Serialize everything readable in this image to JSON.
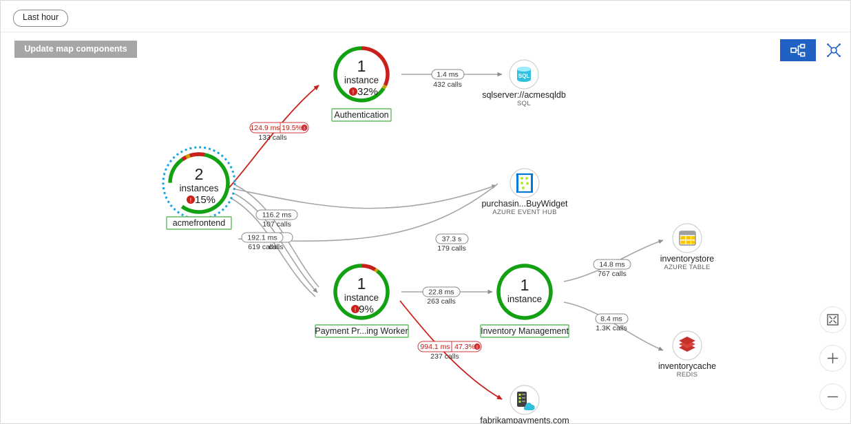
{
  "topbar": {
    "time_range_label": "Last hour"
  },
  "toolbar": {
    "update_map_label": "Update map components",
    "view_hierarchical_icon": "hierarchy-view-icon",
    "view_graph_icon": "graph-view-icon",
    "accent_color": "#1f62c4"
  },
  "zoom_controls": {
    "fit_icon": "fit-to-screen-icon",
    "zoom_in_icon": "plus-icon",
    "zoom_out_icon": "minus-icon"
  },
  "colors": {
    "healthy": "#12a112",
    "error": "#c9201b",
    "warning": "#c8a200",
    "edge": "#a5a5a5",
    "selection": "#18a5e0"
  },
  "nodes": [
    {
      "id": "acmefrontend",
      "name": "acmefrontend",
      "count": "2",
      "count_unit": "instances",
      "error_pct": "15%",
      "selected": true,
      "kind": "app",
      "green_pct": 85,
      "red_pct": 13,
      "warn_pct": 2
    },
    {
      "id": "authentication",
      "name": "Authentication",
      "count": "1",
      "count_unit": "instance",
      "error_pct": "32%",
      "selected": false,
      "kind": "app",
      "green_pct": 66,
      "red_pct": 32,
      "warn_pct": 2
    },
    {
      "id": "payment-processing-worker",
      "name": "Payment Pr...ing Worker",
      "count": "1",
      "count_unit": "instance",
      "error_pct": "9%",
      "selected": false,
      "kind": "app",
      "green_pct": 90,
      "red_pct": 9,
      "warn_pct": 1
    },
    {
      "id": "inventory-management",
      "name": "Inventory Management",
      "count": "1",
      "count_unit": "instance",
      "error_pct": "",
      "selected": false,
      "kind": "app",
      "green_pct": 100,
      "red_pct": 0,
      "warn_pct": 0
    },
    {
      "id": "acmesqldb",
      "name": "sqlserver://acmesqldb",
      "type_label": "SQL",
      "kind": "dependency",
      "icon": "sql-database-icon"
    },
    {
      "id": "purchasing-buywidget",
      "name": "purchasin...BuyWidget",
      "type_label": "AZURE EVENT HUB",
      "kind": "dependency",
      "icon": "event-hub-icon"
    },
    {
      "id": "inventorystore",
      "name": "inventorystore",
      "type_label": "AZURE TABLE",
      "kind": "dependency",
      "icon": "azure-table-icon"
    },
    {
      "id": "inventorycache",
      "name": "inventorycache",
      "type_label": "REDIS",
      "kind": "dependency",
      "icon": "redis-icon"
    },
    {
      "id": "fabrikampayments",
      "name": "fabrikampayments.com",
      "type_label": "",
      "kind": "dependency",
      "icon": "external-server-cloud-icon"
    }
  ],
  "edges": [
    {
      "id": "acmefrontend-authentication",
      "duration": "124.9 ms",
      "error_pct": "19.5%",
      "calls": "133 calls",
      "has_error": true
    },
    {
      "id": "authentication-acmesqldb",
      "duration": "1.4 ms",
      "error_pct": "",
      "calls": "432 calls",
      "has_error": false
    },
    {
      "id": "acmefrontend-buywidget",
      "duration": "116.2 ms",
      "error_pct": "",
      "calls": "107 calls",
      "has_error": false
    },
    {
      "id": "acmefrontend-payment",
      "duration": "192.1 ms",
      "error_pct": "",
      "calls": "619 calls",
      "has_error": false
    },
    {
      "id": "acmefrontend-hidden",
      "duration": "ms",
      "error_pct": "",
      "calls": "calls",
      "has_error": false
    },
    {
      "id": "payment-buywidget",
      "duration": "37.3 s",
      "error_pct": "",
      "calls": "179 calls",
      "has_error": false
    },
    {
      "id": "payment-inventory",
      "duration": "22.8 ms",
      "error_pct": "",
      "calls": "263 calls",
      "has_error": false
    },
    {
      "id": "payment-fabrikam",
      "duration": "994.1 ms",
      "error_pct": "47.3%",
      "calls": "237 calls",
      "has_error": true
    },
    {
      "id": "inventory-inventorystore",
      "duration": "14.8 ms",
      "error_pct": "",
      "calls": "767 calls",
      "has_error": false
    },
    {
      "id": "inventory-inventorycache",
      "duration": "8.4 ms",
      "error_pct": "",
      "calls": "1.3K calls",
      "has_error": false
    }
  ]
}
